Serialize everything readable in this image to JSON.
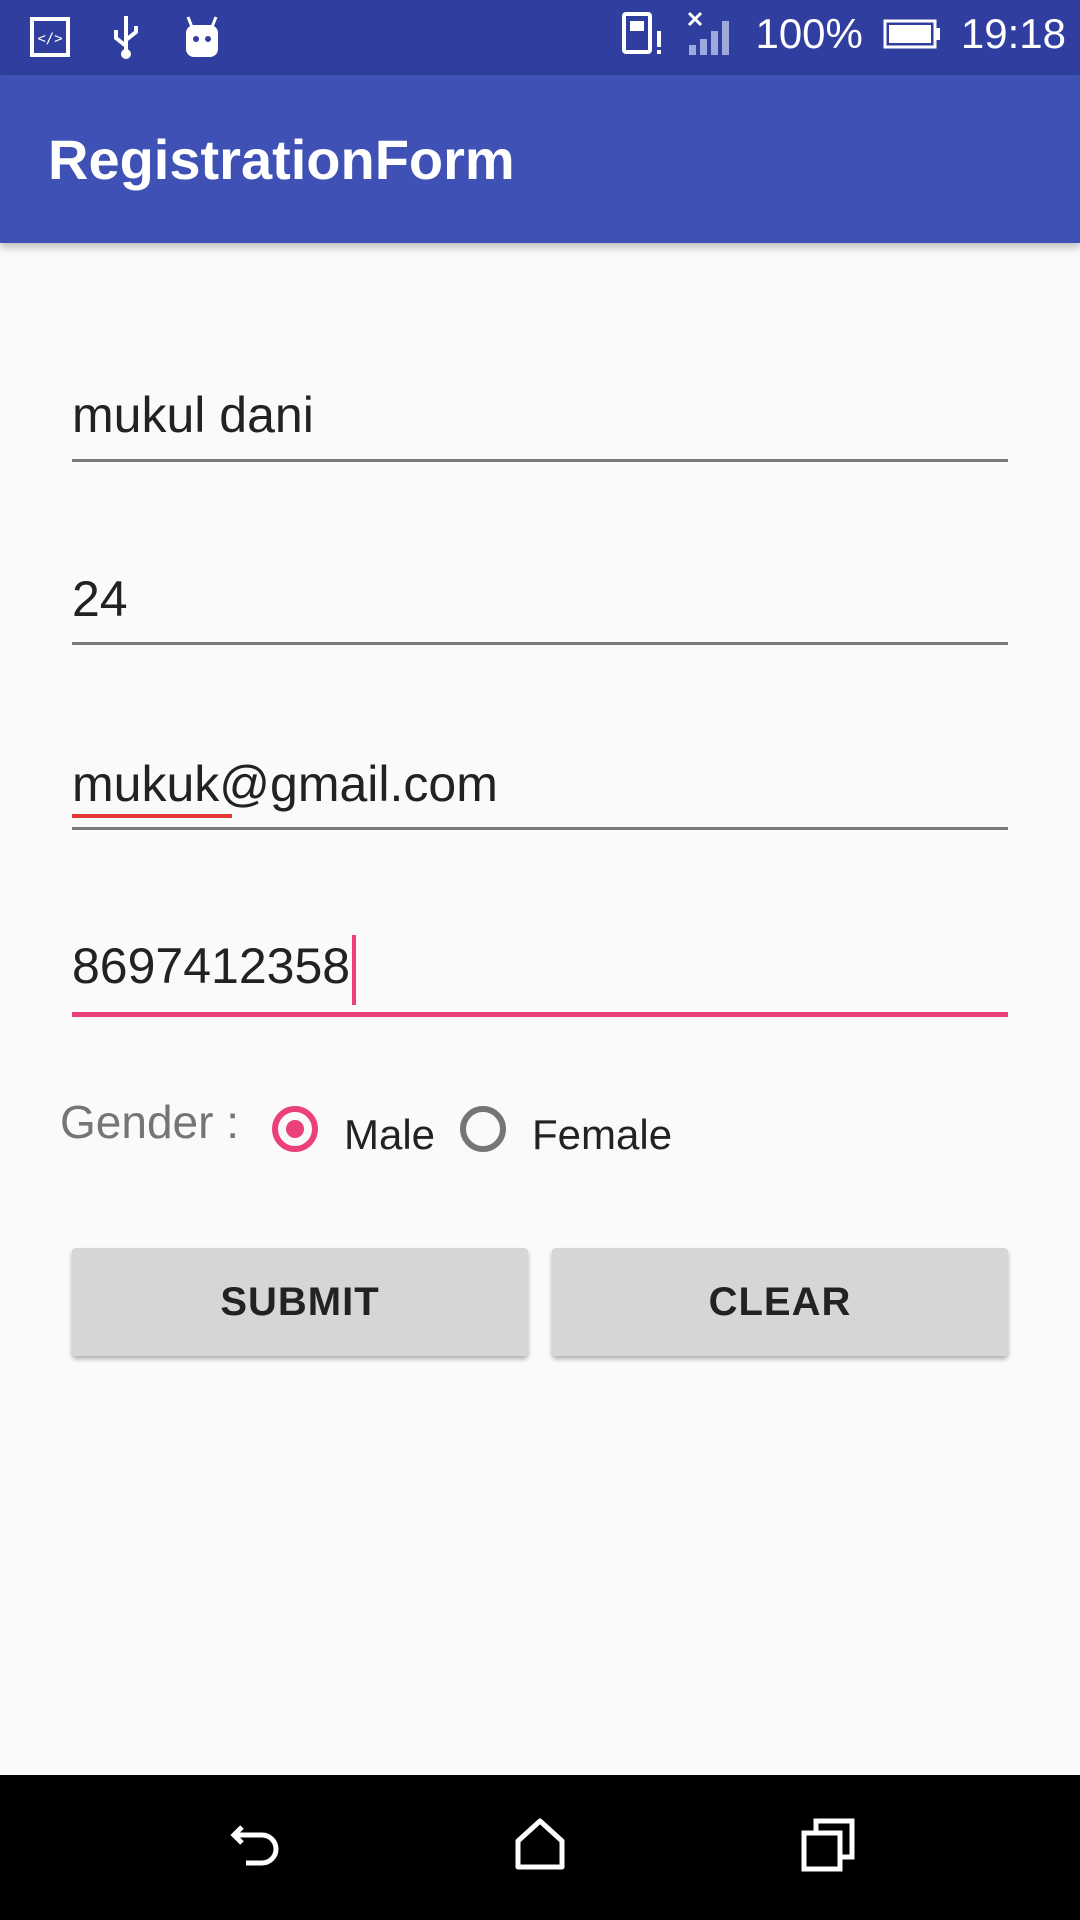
{
  "status_bar": {
    "battery_percent": "100%",
    "time": "19:18",
    "icons": [
      "code-icon",
      "usb-icon",
      "android-icon",
      "sim-alert-icon",
      "signal-no-data-icon",
      "battery-icon"
    ]
  },
  "app_bar": {
    "title": "RegistrationForm"
  },
  "form": {
    "name": "mukul dani",
    "age": "24",
    "email": "mukuk@gmail.com",
    "phone": "8697412358",
    "gender_label": "Gender :",
    "gender_options": [
      "Male",
      "Female"
    ],
    "gender_selected": "Male"
  },
  "buttons": {
    "submit": "SUBMIT",
    "clear": "CLEAR"
  },
  "colors": {
    "primary": "#3f51b5",
    "primary_dark": "#303f9f",
    "accent": "#ec407a"
  },
  "nav_bar": {
    "icons": [
      "back-icon",
      "home-icon",
      "recents-icon"
    ]
  }
}
